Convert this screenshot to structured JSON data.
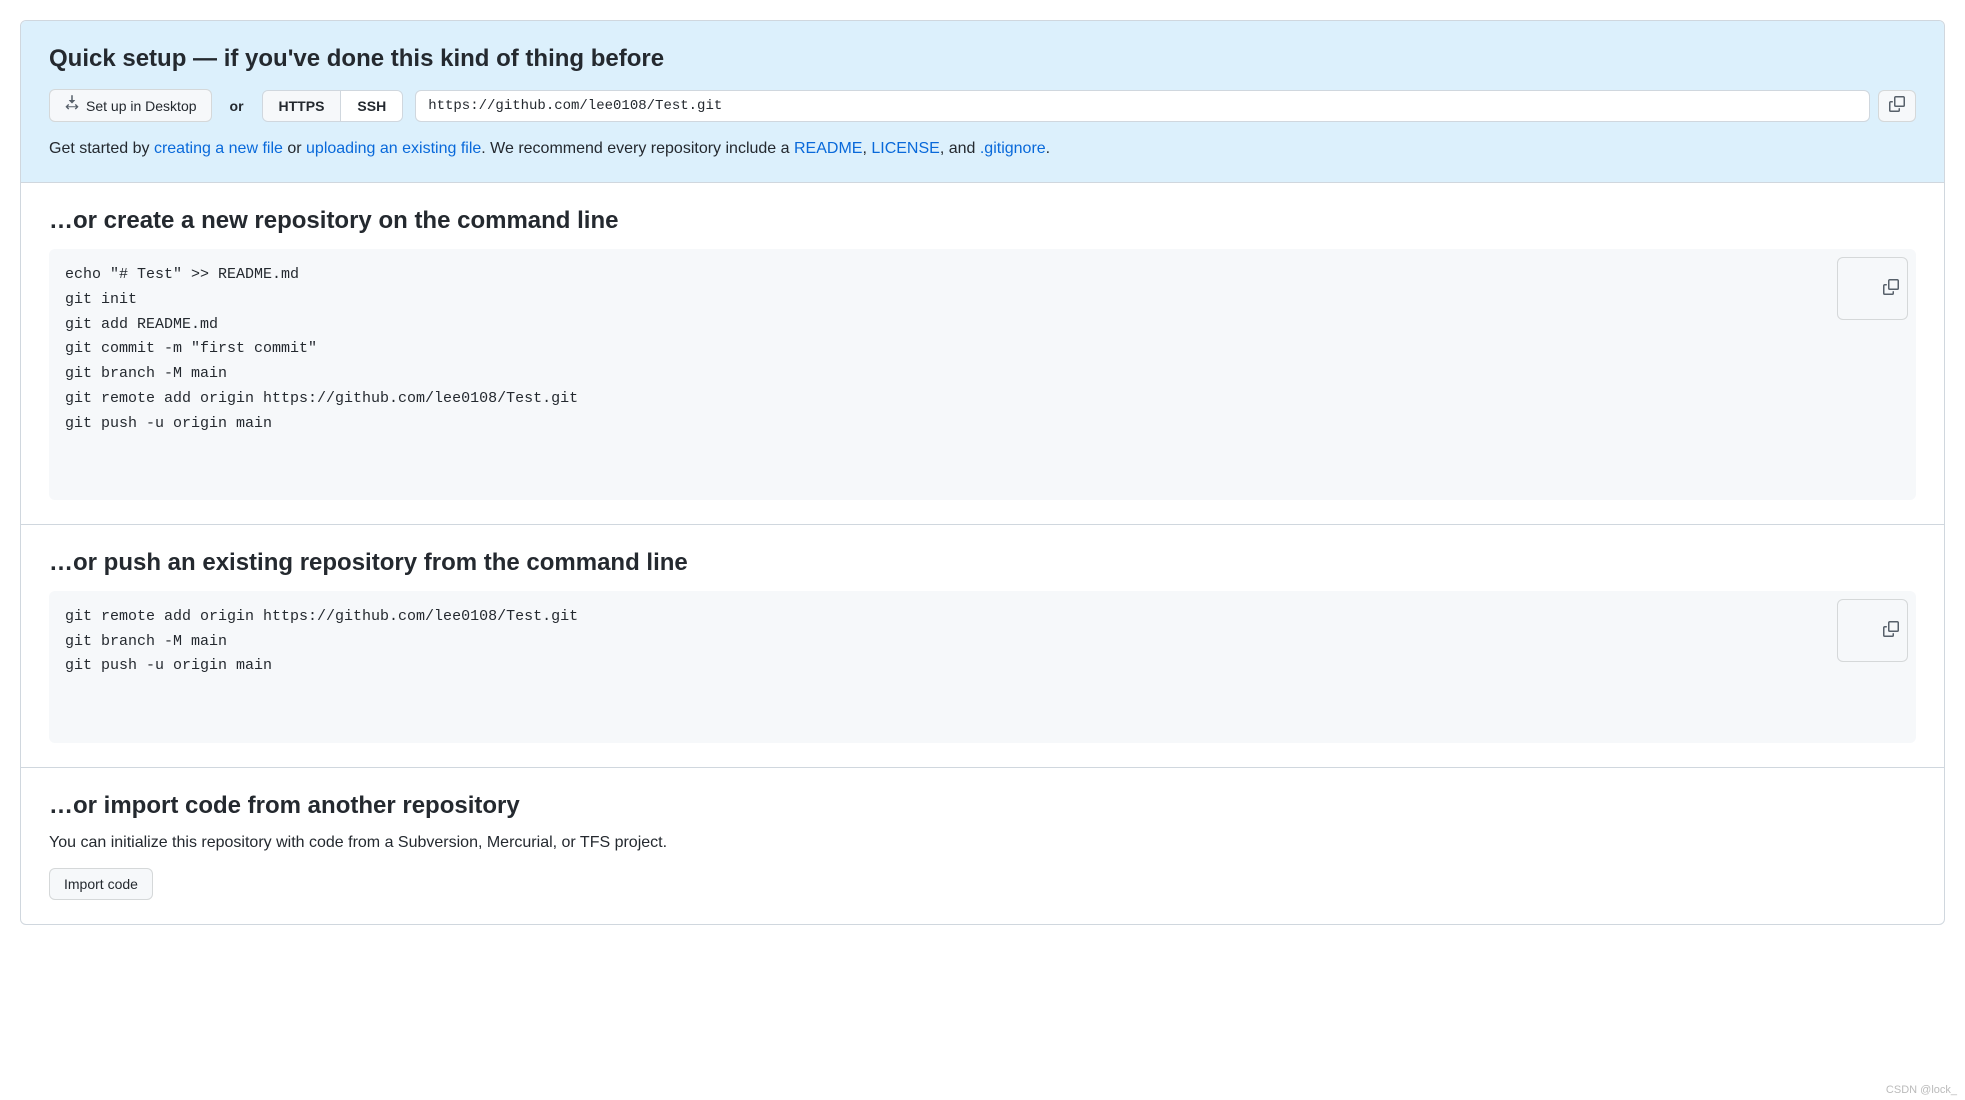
{
  "quick_setup": {
    "heading": "Quick setup — if you've done this kind of thing before",
    "desktop_button": "Set up in Desktop",
    "or": "or",
    "https_label": "HTTPS",
    "ssh_label": "SSH",
    "repo_url": "https://github.com/lee0108/Test.git",
    "help_prefix": "Get started by ",
    "link_create_file": "creating a new file",
    "help_or": " or ",
    "link_upload_file": "uploading an existing file",
    "help_mid": ". We recommend every repository include a ",
    "link_readme": "README",
    "comma_sep": ", ",
    "link_license": "LICENSE",
    "help_and": ", and ",
    "link_gitignore": ".gitignore",
    "help_end": "."
  },
  "create_repo": {
    "heading": "…or create a new repository on the command line",
    "code": "echo \"# Test\" >> README.md\ngit init\ngit add README.md\ngit commit -m \"first commit\"\ngit branch -M main\ngit remote add origin https://github.com/lee0108/Test.git\ngit push -u origin main"
  },
  "push_repo": {
    "heading": "…or push an existing repository from the command line",
    "code": "git remote add origin https://github.com/lee0108/Test.git\ngit branch -M main\ngit push -u origin main"
  },
  "import_repo": {
    "heading": "…or import code from another repository",
    "desc": "You can initialize this repository with code from a Subversion, Mercurial, or TFS project.",
    "button": "Import code"
  },
  "watermark": "CSDN @lock_"
}
